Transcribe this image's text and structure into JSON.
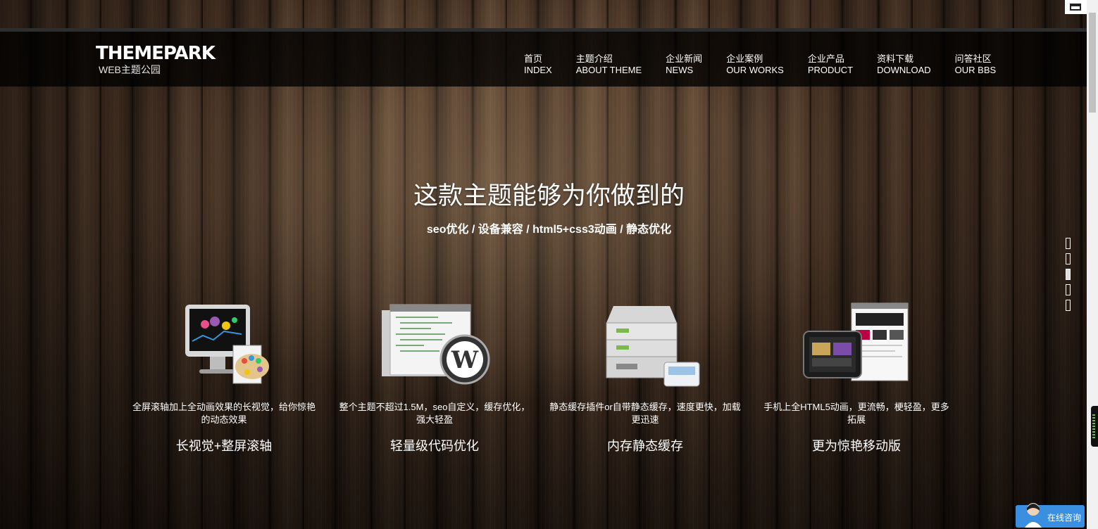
{
  "header": {
    "logo_title": "THEMEPARK",
    "logo_sub": "WEB主题公园",
    "nav": [
      {
        "zh": "首页",
        "en": "INDEX"
      },
      {
        "zh": "主题介绍",
        "en": "ABOUT THEME"
      },
      {
        "zh": "企业新闻",
        "en": "NEWS"
      },
      {
        "zh": "企业案例",
        "en": "OUR WORKS"
      },
      {
        "zh": "企业产品",
        "en": "PRODUCT"
      },
      {
        "zh": "资料下载",
        "en": "DOWNLOAD"
      },
      {
        "zh": "问答社区",
        "en": "OUR BBS"
      }
    ]
  },
  "hero": {
    "title": "这款主题能够为你做到的",
    "subtitle": "seo优化 / 设备兼容 / html5+css3动画 / 静态优化"
  },
  "features": [
    {
      "desc": "全屏滚轴加上全动画效果的长视觉，给你惊艳的动态效果",
      "name": "长视觉+整屏滚轴",
      "icon": "monitor-palette-icon"
    },
    {
      "desc": "整个主题不超过1.5M，seo自定义，缓存优化，强大轻盈",
      "name": "轻量级代码优化",
      "icon": "wordpress-code-icon"
    },
    {
      "desc": "静态缓存插件or自带静态缓存，速度更快，加载更迅速",
      "name": "内存静态缓存",
      "icon": "server-icon"
    },
    {
      "desc": "手机上全HTML5动画，更流畅，梗轻盈，更多拓展",
      "name": "更为惊艳移动版",
      "icon": "tablet-browser-icon"
    }
  ],
  "pager": {
    "count": 5,
    "active_index": 2
  },
  "chat": {
    "label": "在线咨询"
  },
  "colors": {
    "chat_bg": "#3a8fe0",
    "header_bg": "#000000"
  }
}
